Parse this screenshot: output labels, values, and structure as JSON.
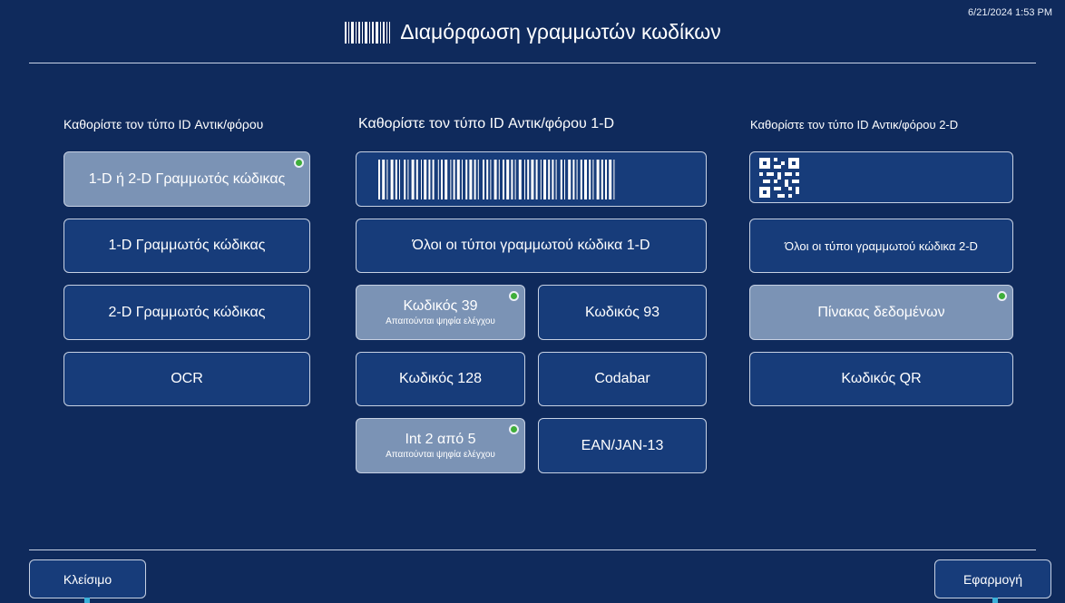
{
  "datetime": "6/21/2024 1:53 PM",
  "header": {
    "title": "Διαμόρφωση γραμμωτών κωδίκων",
    "icon": "barcode-icon"
  },
  "left": {
    "title": "Καθορίστε τον τύπο ID Αντικ/φόρου",
    "items": [
      {
        "label": "1-D ή 2-D Γραμμωτός κώδικας",
        "selected": true
      },
      {
        "label": "1-D Γραμμωτός κώδικας",
        "selected": false
      },
      {
        "label": "2-D Γραμμωτός κώδικας",
        "selected": false
      },
      {
        "label": "OCR",
        "selected": false
      }
    ]
  },
  "middle": {
    "title": "Καθορίστε τον τύπο ID Αντικ/φόρου 1-D",
    "all_label": "Όλοι οι τύποι γραμμωτού κώδικα 1-D",
    "items": [
      {
        "label": "Κωδικός 39",
        "sub": "Απαιτούνται ψηφία ελέγχου",
        "selected": true
      },
      {
        "label": "Κωδικός 93",
        "sub": "",
        "selected": false
      },
      {
        "label": "Κωδικός 128",
        "sub": "",
        "selected": false
      },
      {
        "label": "Codabar",
        "sub": "",
        "selected": false
      },
      {
        "label": "Int 2 από 5",
        "sub": "Απαιτούνται ψηφία ελέγχου",
        "selected": true
      },
      {
        "label": "EAN/JAN-13",
        "sub": "",
        "selected": false
      }
    ]
  },
  "right": {
    "title": "Καθορίστε τον τύπο ID Αντικ/φόρου 2-D",
    "all_label": "Όλοι οι τύποι γραμμωτού κώδικα 2-D",
    "items": [
      {
        "label": "Πίνακας δεδομένων",
        "selected": true
      },
      {
        "label": "Κωδικός QR",
        "selected": false
      }
    ]
  },
  "footer": {
    "close_label": "Κλείσιμο",
    "apply_label": "Εφαρμογή"
  },
  "colors": {
    "background": "#0f2a5c",
    "button": "#173c7a",
    "selected": "#7b93b5",
    "check": "#3fae3a",
    "accent": "#3bb0d8"
  }
}
